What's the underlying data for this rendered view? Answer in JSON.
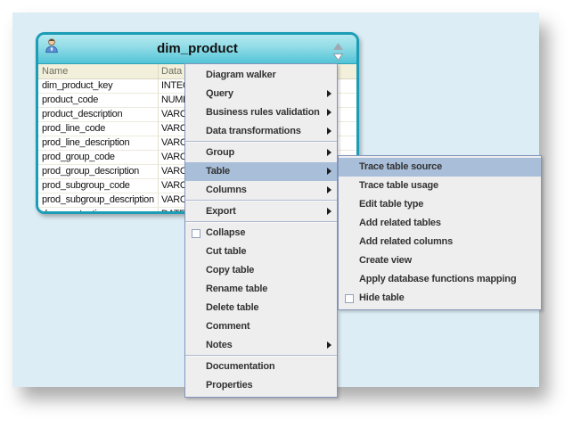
{
  "table_card": {
    "title": "dim_product",
    "column_headers": [
      "Name",
      "Data type"
    ],
    "rows": [
      {
        "name": "dim_product_key",
        "type": "INTEGER"
      },
      {
        "name": "product_code",
        "type": "NUMBER"
      },
      {
        "name": "product_description",
        "type": "VARCHAR"
      },
      {
        "name": "prod_line_code",
        "type": "VARCHAR"
      },
      {
        "name": "prod_line_description",
        "type": "VARCHAR"
      },
      {
        "name": "prod_group_code",
        "type": "VARCHAR"
      },
      {
        "name": "prod_group_description",
        "type": "VARCHAR"
      },
      {
        "name": "prod_subgroup_code",
        "type": "VARCHAR"
      },
      {
        "name": "prod_subgroup_description",
        "type": "VARCHAR"
      },
      {
        "name": "dss_create_time",
        "type": "DATE"
      }
    ],
    "icons": [
      "person-icon",
      "scroll-up-icon",
      "scroll-down-icon"
    ]
  },
  "context_menu": {
    "items": [
      {
        "label": "Diagram walker"
      },
      {
        "label": "Query",
        "submenu_arrow": true
      },
      {
        "label": "Business rules validation",
        "submenu_arrow": true
      },
      {
        "label": "Data transformations",
        "submenu_arrow": true
      },
      {
        "separator": true
      },
      {
        "label": "Group",
        "submenu_arrow": true
      },
      {
        "label": "Table",
        "submenu_arrow": true,
        "highlighted": true
      },
      {
        "label": "Columns",
        "submenu_arrow": true
      },
      {
        "separator": true
      },
      {
        "label": "Export",
        "submenu_arrow": true
      },
      {
        "separator": true
      },
      {
        "label": "Collapse",
        "checkbox": true
      },
      {
        "label": "Cut table"
      },
      {
        "label": "Copy table"
      },
      {
        "label": "Rename table"
      },
      {
        "label": "Delete table"
      },
      {
        "label": "Comment"
      },
      {
        "label": "Notes",
        "submenu_arrow": true
      },
      {
        "separator": true
      },
      {
        "label": "Documentation"
      },
      {
        "label": "Properties"
      }
    ]
  },
  "submenu": {
    "items": [
      {
        "label": "Trace table source",
        "highlighted": true
      },
      {
        "label": "Trace table usage"
      },
      {
        "label": "Edit table type"
      },
      {
        "label": "Add related tables"
      },
      {
        "label": "Add related columns"
      },
      {
        "label": "Create view"
      },
      {
        "label": "Apply database functions mapping"
      },
      {
        "label": "Hide table",
        "checkbox": true
      }
    ]
  },
  "colors": {
    "canvas": "#ddedf5",
    "table_border": "#1b9db6",
    "table_header_top": "#b5e9f0",
    "table_header_bottom": "#52c4d7",
    "column_header_bg": "#f2efdb",
    "menu_bg": "#eeeeee",
    "menu_border": "#8495ba",
    "menu_highlight": "#a9bed9",
    "menu_text": "#333333"
  }
}
